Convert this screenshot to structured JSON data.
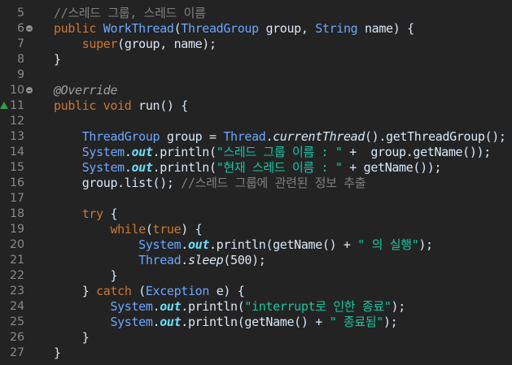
{
  "editor": {
    "lines": [
      {
        "num": "5",
        "parts": [
          {
            "cls": "c",
            "text": "//스레드 그룹, 스레드 이름"
          }
        ]
      },
      {
        "num": "6",
        "parts": [
          {
            "cls": "k",
            "text": "public "
          },
          {
            "cls": "t",
            "text": "WorkThread"
          },
          {
            "cls": "id",
            "text": "("
          },
          {
            "cls": "t",
            "text": "ThreadGroup"
          },
          {
            "cls": "id",
            "text": " group, "
          },
          {
            "cls": "t",
            "text": "String"
          },
          {
            "cls": "id",
            "text": " name) {"
          }
        ]
      },
      {
        "num": "7",
        "parts": [
          {
            "cls": "k",
            "text": "    super"
          },
          {
            "cls": "id",
            "text": "(group, name);"
          }
        ]
      },
      {
        "num": "8",
        "parts": [
          {
            "cls": "id",
            "text": "}"
          }
        ]
      },
      {
        "num": "9",
        "parts": []
      },
      {
        "num": "10",
        "parts": [
          {
            "cls": "ann",
            "text": "@Override"
          }
        ]
      },
      {
        "num": "11",
        "parts": [
          {
            "cls": "k",
            "text": "public void "
          },
          {
            "cls": "id",
            "text": "run() {"
          }
        ]
      },
      {
        "num": "12",
        "parts": []
      },
      {
        "num": "13",
        "parts": [
          {
            "cls": "t",
            "text": "    ThreadGroup"
          },
          {
            "cls": "id",
            "text": " group = "
          },
          {
            "cls": "t",
            "text": "Thread"
          },
          {
            "cls": "id",
            "text": "."
          },
          {
            "cls": "ital id",
            "text": "currentThread"
          },
          {
            "cls": "id",
            "text": "().getThreadGroup();"
          }
        ]
      },
      {
        "num": "14",
        "parts": [
          {
            "cls": "t",
            "text": "    System"
          },
          {
            "cls": "id",
            "text": "."
          },
          {
            "cls": "ital bold sf",
            "text": "out"
          },
          {
            "cls": "id",
            "text": ".println("
          },
          {
            "cls": "s",
            "text": "\"스레드 그룹 이름 : \""
          },
          {
            "cls": "id",
            "text": " +  group.getName());"
          }
        ]
      },
      {
        "num": "15",
        "parts": [
          {
            "cls": "t",
            "text": "    System"
          },
          {
            "cls": "id",
            "text": "."
          },
          {
            "cls": "ital bold sf",
            "text": "out"
          },
          {
            "cls": "id",
            "text": ".println("
          },
          {
            "cls": "s",
            "text": "\"현재 스레드 이름 : \""
          },
          {
            "cls": "id",
            "text": " + getName());"
          }
        ]
      },
      {
        "num": "16",
        "parts": [
          {
            "cls": "id",
            "text": "    group.list(); "
          },
          {
            "cls": "c",
            "text": "//스레드 그룹에 관련된 정보 추출"
          }
        ]
      },
      {
        "num": "17",
        "parts": []
      },
      {
        "num": "18",
        "parts": [
          {
            "cls": "k",
            "text": "    try"
          },
          {
            "cls": "id",
            "text": " {"
          }
        ]
      },
      {
        "num": "19",
        "parts": [
          {
            "cls": "k",
            "text": "        while"
          },
          {
            "cls": "id",
            "text": "("
          },
          {
            "cls": "k",
            "text": "true"
          },
          {
            "cls": "id",
            "text": ") {"
          }
        ]
      },
      {
        "num": "20",
        "parts": [
          {
            "cls": "t",
            "text": "            System"
          },
          {
            "cls": "id",
            "text": "."
          },
          {
            "cls": "ital bold sf",
            "text": "out"
          },
          {
            "cls": "id",
            "text": ".println(getName() + "
          },
          {
            "cls": "s",
            "text": "\" 의 실행\""
          },
          {
            "cls": "id",
            "text": ");"
          }
        ]
      },
      {
        "num": "21",
        "parts": [
          {
            "cls": "t",
            "text": "            Thread"
          },
          {
            "cls": "id",
            "text": "."
          },
          {
            "cls": "ital id",
            "text": "sleep"
          },
          {
            "cls": "id",
            "text": "(500);"
          }
        ]
      },
      {
        "num": "22",
        "parts": [
          {
            "cls": "id",
            "text": "        }"
          }
        ]
      },
      {
        "num": "23",
        "parts": [
          {
            "cls": "id",
            "text": "    } "
          },
          {
            "cls": "k",
            "text": "catch"
          },
          {
            "cls": "id",
            "text": " ("
          },
          {
            "cls": "t",
            "text": "Exception"
          },
          {
            "cls": "id",
            "text": " e) {"
          }
        ]
      },
      {
        "num": "24",
        "parts": [
          {
            "cls": "t",
            "text": "        System"
          },
          {
            "cls": "id",
            "text": "."
          },
          {
            "cls": "ital bold sf",
            "text": "out"
          },
          {
            "cls": "id",
            "text": ".println("
          },
          {
            "cls": "s",
            "text": "\"interrupt로 인한 종료\""
          },
          {
            "cls": "id",
            "text": ");"
          }
        ]
      },
      {
        "num": "25",
        "parts": [
          {
            "cls": "t",
            "text": "        System"
          },
          {
            "cls": "id",
            "text": "."
          },
          {
            "cls": "ital bold sf",
            "text": "out"
          },
          {
            "cls": "id",
            "text": ".println(getName() + "
          },
          {
            "cls": "s",
            "text": "\" 종료됨\""
          },
          {
            "cls": "id",
            "text": ");"
          }
        ]
      },
      {
        "num": "26",
        "parts": [
          {
            "cls": "id",
            "text": "    }"
          }
        ]
      },
      {
        "num": "27",
        "parts": [
          {
            "cls": "id",
            "text": "}"
          }
        ]
      }
    ],
    "fold_markers": [
      "6",
      "10"
    ],
    "override_marker": "11"
  }
}
